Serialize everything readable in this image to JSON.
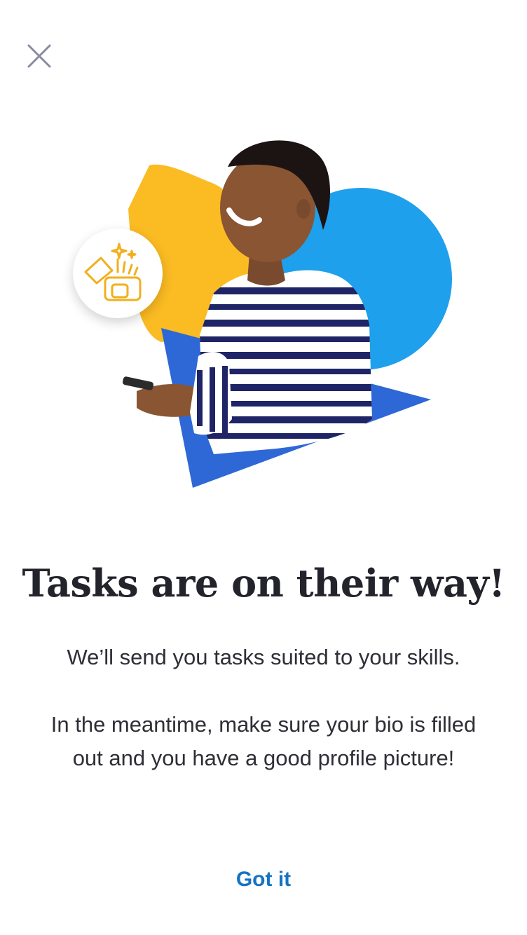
{
  "close_button": {
    "icon": "close-icon"
  },
  "hero": {
    "description_icon": "gift-badge-icon",
    "colors": {
      "yellow": "#FBBB23",
      "light_blue": "#1EA0EC",
      "dark_blue": "#2D68D6",
      "badge_gold": "#F0B01E"
    }
  },
  "content": {
    "headline": "Tasks are on their way!",
    "paragraph_1": "We’ll send you tasks suited to your skills.",
    "paragraph_2": "In the meantime, make sure your bio is filled out and you have a good profile picture!"
  },
  "actions": {
    "got_it_label": "Got it",
    "accent_color": "#1473C3"
  }
}
